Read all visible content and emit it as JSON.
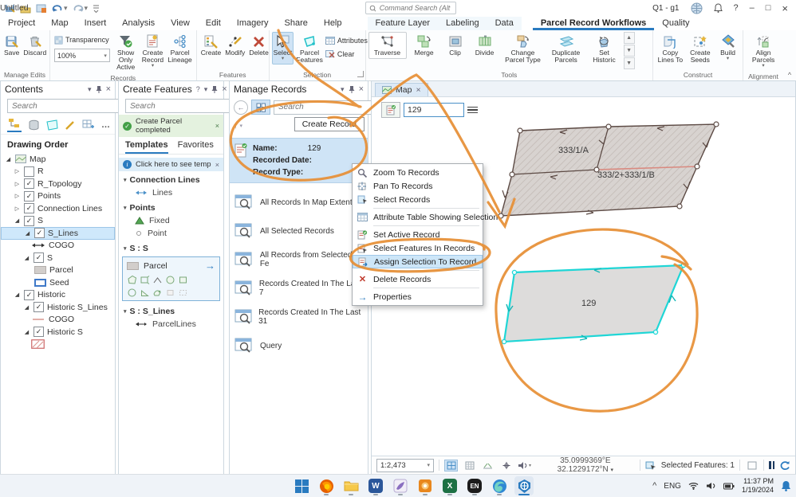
{
  "icons": {
    "close": "×",
    "chevron_down": "▾",
    "expand_collapsed": "▷",
    "expand_expanded": "◢",
    "check": "✓",
    "more": "…",
    "help": "?",
    "minimize": "–",
    "maximize": "□",
    "arrow_right": "→",
    "back": "←",
    "sort_up": "↑",
    "collapse_ribbon": "^",
    "tray_expand": "^",
    "info": "i"
  },
  "colors": {
    "accent": "#2a7bc0",
    "annotation": "#e78f35",
    "selection_cyan": "#1fd6d6",
    "parcel_fill": "#d8d3d0",
    "historic_edge": "#5c4a44"
  },
  "titlebar": {
    "project": "Untitled",
    "search_placeholder": "Command Search (Alt+Q)",
    "account": "Q1 - g1"
  },
  "tabs": {
    "main": [
      "Project",
      "Map",
      "Insert",
      "Analysis",
      "View",
      "Edit",
      "Imagery",
      "Share",
      "Help"
    ],
    "contextual": [
      "Feature Layer",
      "Labeling",
      "Data"
    ],
    "workflow": [
      "Parcel Record Workflows",
      "Quality"
    ]
  },
  "ribbon": {
    "manage_edits": {
      "label": "Manage Edits",
      "save": "Save",
      "discard": "Discard"
    },
    "records": {
      "label": "Records",
      "transparency": "Transparency",
      "transparency_value": "100%",
      "show_only_active": "Show Only\nActive",
      "create_record": "Create\nRecord",
      "parcel_lineage": "Parcel\nLineage"
    },
    "features": {
      "label": "Features",
      "create": "Create",
      "modify": "Modify",
      "delete": "Delete"
    },
    "selection": {
      "label": "Selection",
      "select": "Select",
      "parcel_features": "Parcel\nFeatures",
      "attributes": "Attributes",
      "clear": "Clear"
    },
    "tools": {
      "label": "Tools",
      "traverse": "Traverse",
      "merge": "Merge",
      "clip": "Clip",
      "divide": "Divide",
      "change_parcel_type": "Change\nParcel Type",
      "duplicate_parcels": "Duplicate\nParcels",
      "set_historic": "Set\nHistoric"
    },
    "construct": {
      "label": "Construct",
      "copy_lines_to": "Copy\nLines To",
      "create_seeds": "Create\nSeeds",
      "build": "Build"
    },
    "alignment": {
      "label": "Alignment",
      "align_parcels": "Align\nParcels"
    }
  },
  "contents": {
    "title": "Contents",
    "search_placeholder": "Search",
    "section": "Drawing Order",
    "tree": [
      {
        "label": "Map"
      },
      {
        "label": "R"
      },
      {
        "label": "R_Topology"
      },
      {
        "label": "Points"
      },
      {
        "label": "Connection Lines"
      },
      {
        "label": "S"
      },
      {
        "label": "S_Lines"
      },
      {
        "label": "COGO"
      },
      {
        "label": "S"
      },
      {
        "label": "Parcel"
      },
      {
        "label": "Seed"
      },
      {
        "label": "Historic"
      },
      {
        "label": "Historic S_Lines"
      },
      {
        "label": "COGO"
      },
      {
        "label": "Historic S"
      }
    ]
  },
  "create_features": {
    "title": "Create Features",
    "search_placeholder": "Search",
    "banner_success": "Create Parcel completed",
    "tab_templates": "Templates",
    "tab_favorites": "Favorites",
    "banner_info": "Click here to see templat",
    "group_connection_lines": "Connection Lines",
    "item_lines": "Lines",
    "group_points": "Points",
    "item_fixed": "Fixed",
    "item_point": "Point",
    "group_s_s": "S : S",
    "item_parcel": "Parcel",
    "group_s_slines": "S : S_Lines",
    "item_parcellines": "ParcelLines"
  },
  "manage_records": {
    "title": "Manage Records",
    "search_placeholder": "Search",
    "create_record_button": "Create Record",
    "card": {
      "name_label": "Name:",
      "name_value": "129",
      "date_label": "Recorded Date:",
      "type_label": "Record Type:"
    },
    "list": [
      "All Records In Map Extent",
      "All Selected Records",
      "All Records from Selected Fe",
      "Records Created In The Last 7",
      "Records Created In The Last 31",
      "Query"
    ]
  },
  "context_menu": {
    "items": [
      "Zoom To Records",
      "Pan To Records",
      "Select Records",
      "Attribute Table Showing Selection",
      "Set Active Record",
      "Select Features In Records",
      "Assign Selection To Record",
      "Delete Records",
      "Properties"
    ]
  },
  "map": {
    "tab": "Map",
    "record_input_value": "129",
    "parcel_labels": {
      "upper_left": "333/1/A",
      "upper_right": "333/2+333/1/B",
      "selected": "129"
    },
    "status": {
      "scale": "1:2,473",
      "coords": "35.0999369°E 32.1229172°N",
      "selected": "Selected Features: 1"
    }
  },
  "taskbar": {
    "language": "ENG",
    "time": "11:37 PM",
    "date": "1/19/2024",
    "word": "W",
    "excel": "X",
    "lang_icon": "EN"
  }
}
